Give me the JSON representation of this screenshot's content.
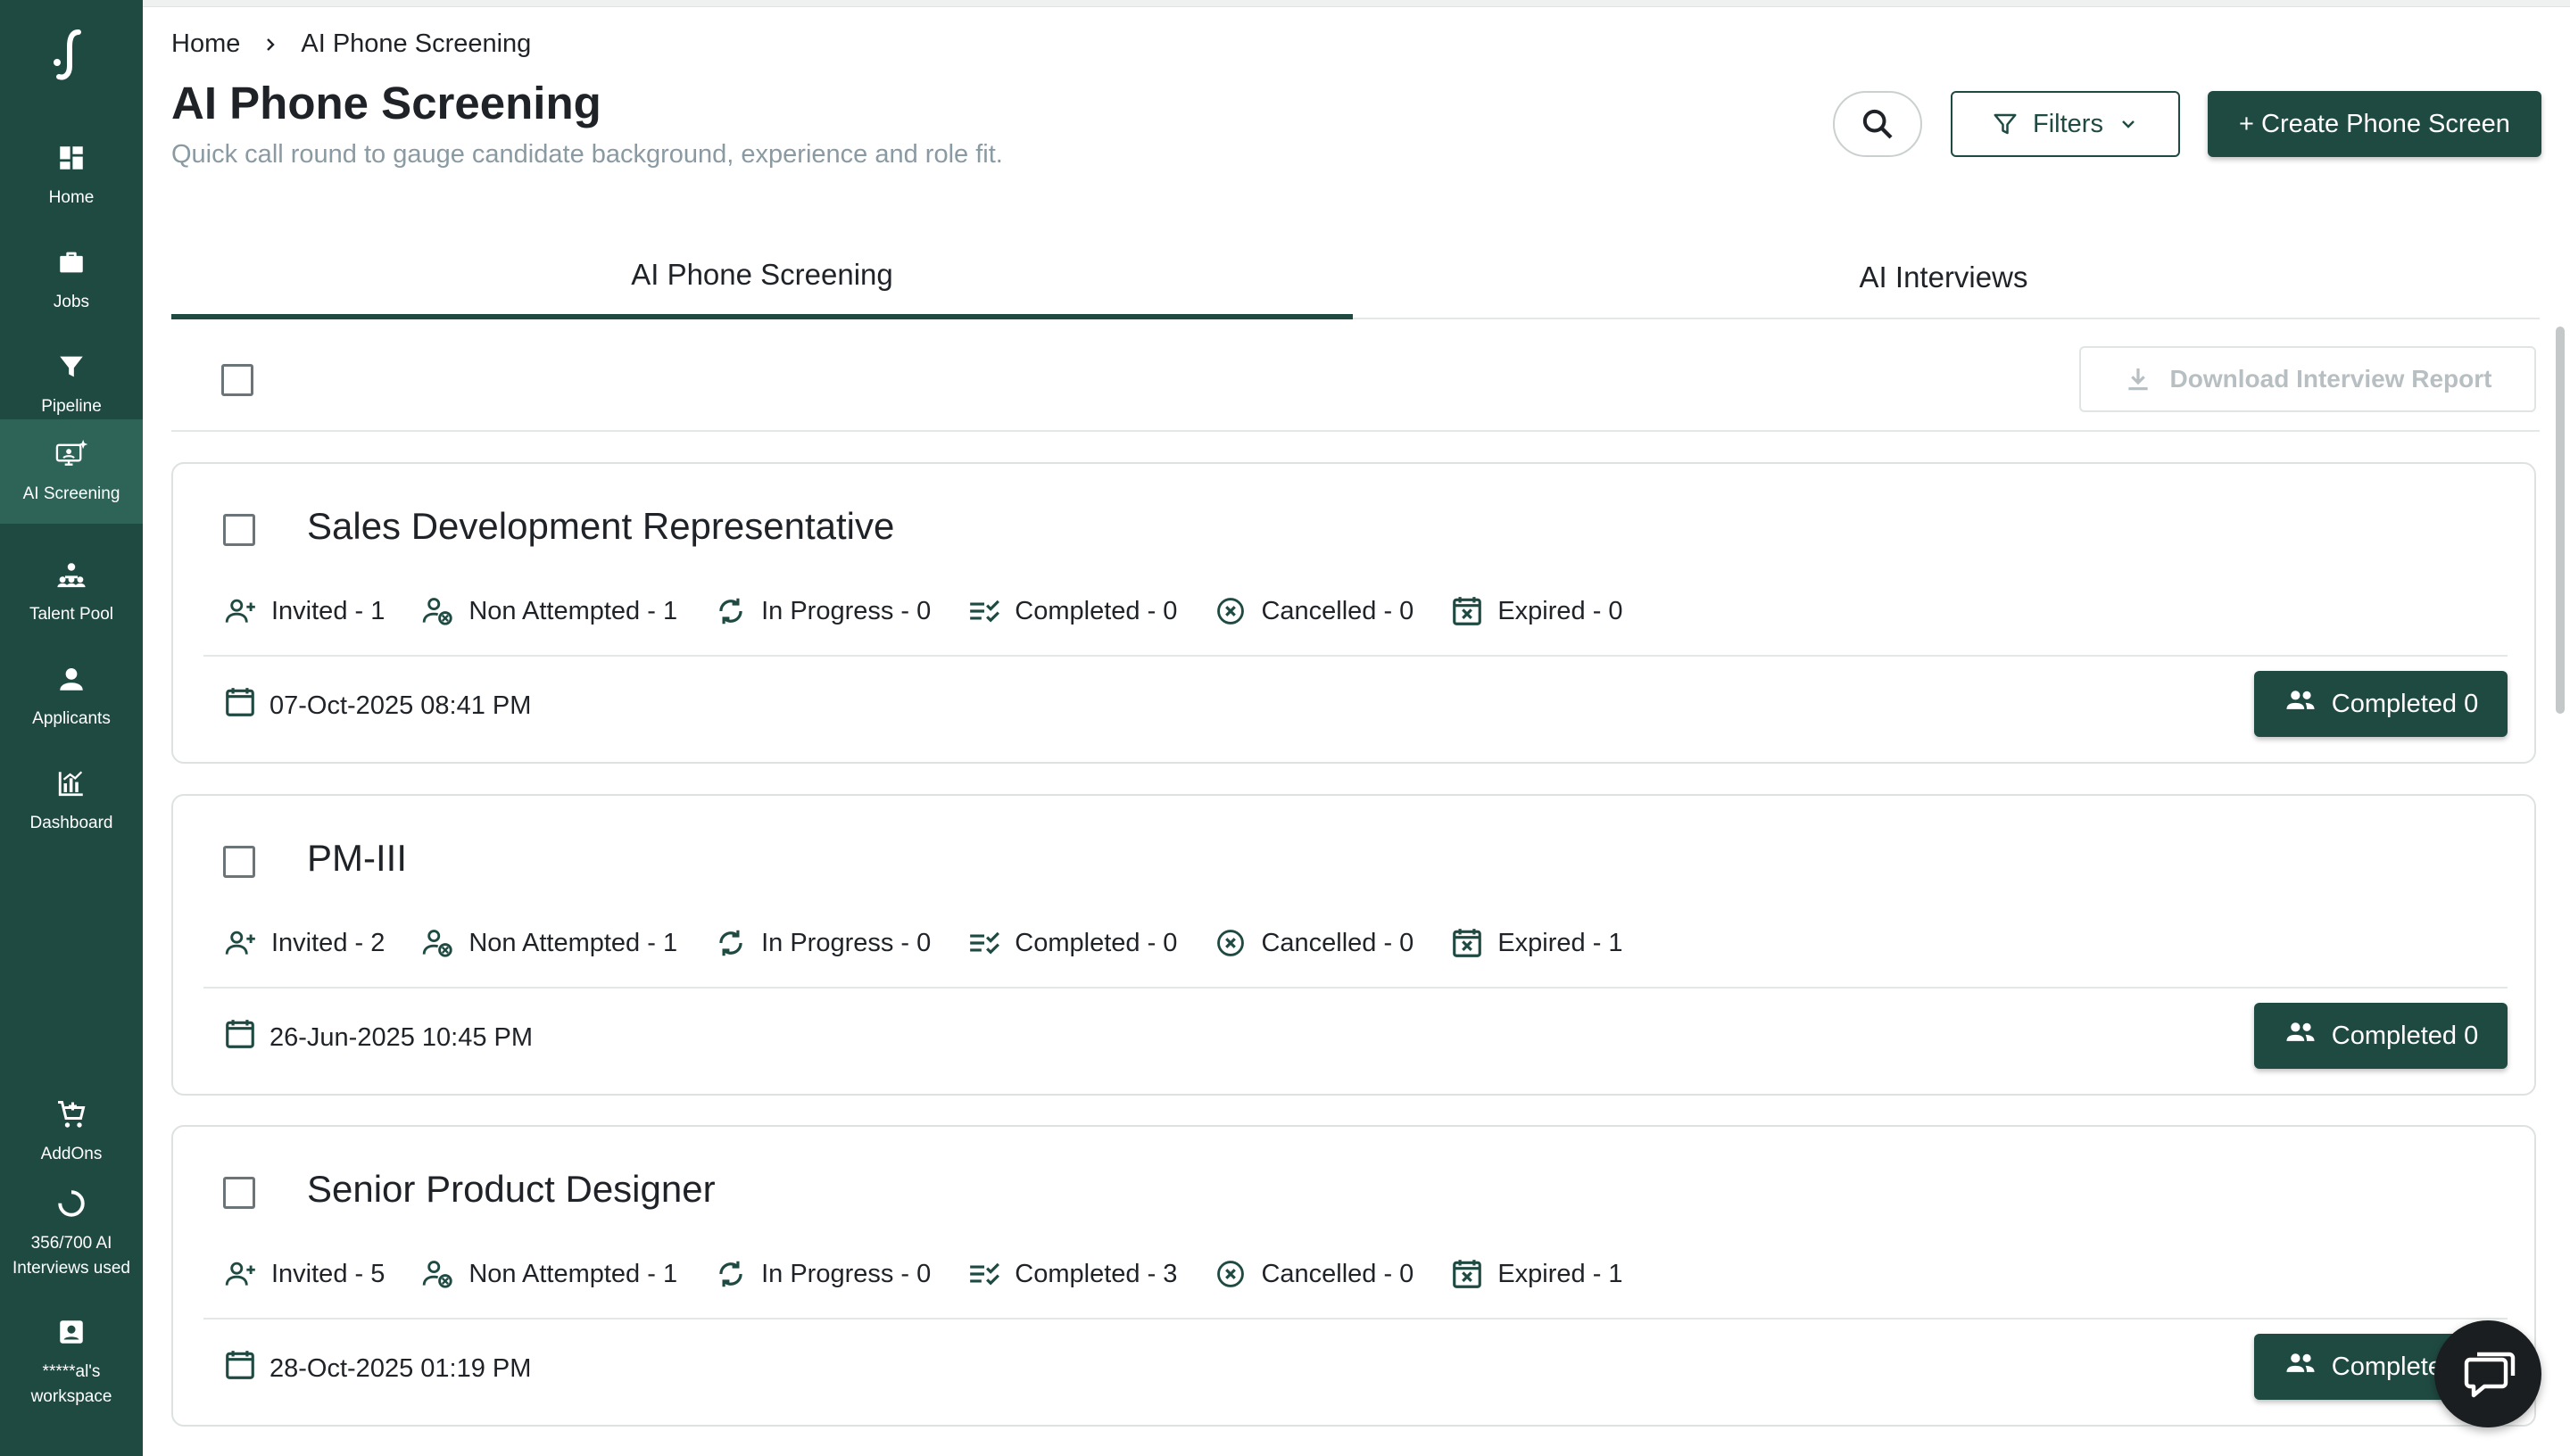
{
  "sidebar": {
    "items": [
      {
        "label": "Home",
        "icon": "dashboard-grid-icon"
      },
      {
        "label": "Jobs",
        "icon": "briefcase-icon"
      },
      {
        "label": "Pipeline",
        "icon": "funnel-icon"
      },
      {
        "label": "AI Screening",
        "icon": "ai-monitor-icon",
        "active": true
      },
      {
        "label": "Talent Pool",
        "icon": "group-icon"
      },
      {
        "label": "Applicants",
        "icon": "person-icon"
      },
      {
        "label": "Dashboard",
        "icon": "bar-chart-icon"
      }
    ],
    "bottom": {
      "addons": "AddOns",
      "usage": "356/700 AI Interviews used",
      "workspace": "*****al's workspace"
    }
  },
  "breadcrumb": {
    "home": "Home",
    "current": "AI Phone Screening"
  },
  "header": {
    "title": "AI Phone Screening",
    "subtitle": "Quick call round to gauge candidate background, experience and role fit.",
    "filters_label": "Filters",
    "create_label": "+ Create Phone Screen"
  },
  "tabs": [
    {
      "label": "AI Phone Screening",
      "active": true
    },
    {
      "label": "AI Interviews",
      "active": false
    }
  ],
  "toolbar": {
    "download_label": "Download Interview Report"
  },
  "cards": [
    {
      "title": "Sales Development Representative",
      "invited": "Invited - 1",
      "non_attempted": "Non Attempted - 1",
      "in_progress": "In Progress - 0",
      "completed": "Completed - 0",
      "cancelled": "Cancelled - 0",
      "expired": "Expired - 0",
      "date": "07-Oct-2025 08:41 PM",
      "button": "Completed 0"
    },
    {
      "title": "PM-III",
      "invited": "Invited - 2",
      "non_attempted": "Non Attempted - 1",
      "in_progress": "In Progress - 0",
      "completed": "Completed - 0",
      "cancelled": "Cancelled - 0",
      "expired": "Expired - 1",
      "date": "26-Jun-2025 10:45 PM",
      "button": "Completed 0"
    },
    {
      "title": "Senior Product Designer",
      "invited": "Invited - 5",
      "non_attempted": "Non Attempted - 1",
      "in_progress": "In Progress - 0",
      "completed": "Completed - 3",
      "cancelled": "Cancelled - 0",
      "expired": "Expired - 1",
      "date": "28-Oct-2025 01:19 PM",
      "button": "Completed 3"
    }
  ],
  "colors": {
    "brand": "#1f4a42",
    "active_nav": "#2d6457",
    "subtitle": "#8a9aa3"
  }
}
